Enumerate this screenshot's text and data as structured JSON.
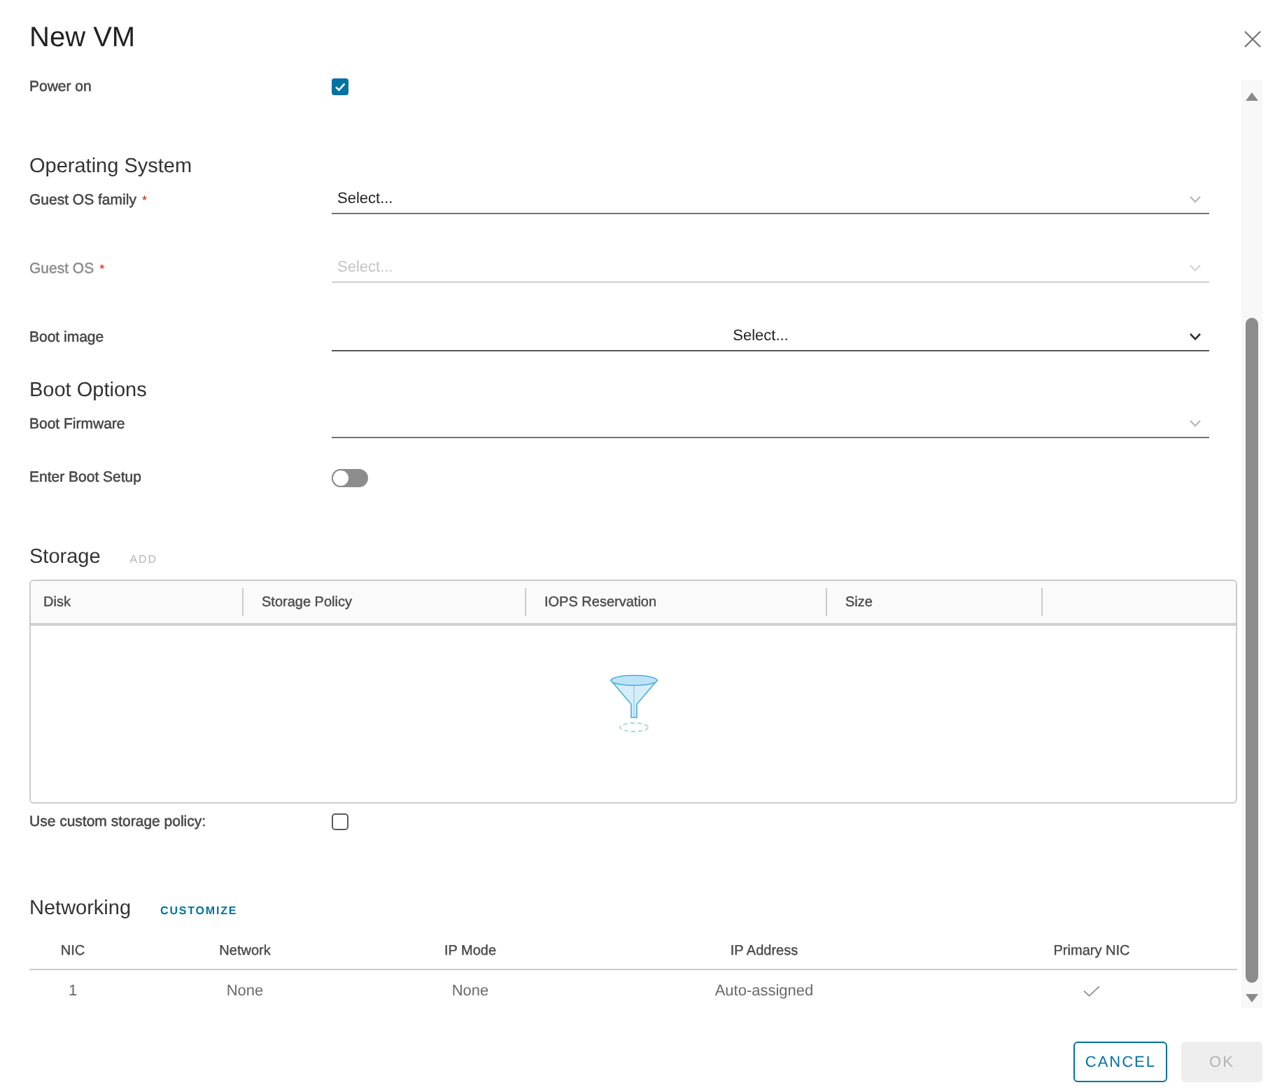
{
  "dialog": {
    "title": "New VM"
  },
  "fields": [
    {
      "kind": "checkbox",
      "label": "Power on",
      "checked": true
    }
  ],
  "sections": [
    {
      "title": "Operating System",
      "fields": [
        {
          "kind": "select",
          "label": "Guest OS family",
          "required_mark": "*",
          "value": "Select...",
          "disabled": false
        },
        {
          "kind": "select",
          "label": "Guest OS",
          "required_mark": "*",
          "value": "Select...",
          "disabled": true
        },
        {
          "kind": "native-select",
          "label": "Boot image",
          "value": "Select...",
          "disabled": false
        }
      ]
    },
    {
      "title": "Boot Options",
      "fields": [
        {
          "kind": "select",
          "label": "Boot Firmware",
          "disabled": false
        },
        {
          "kind": "toggle",
          "label": "Enter Boot Setup",
          "on": false
        }
      ]
    },
    {
      "title": "Storage",
      "action": {
        "label": "ADD",
        "disabled": true
      },
      "grid": {
        "columns": [
          "Disk",
          "Storage Policy",
          "IOPS Reservation",
          "Size"
        ]
      },
      "fields": [
        {
          "kind": "checkbox",
          "label": "Use custom storage policy:",
          "checked": false
        }
      ]
    },
    {
      "title": "Networking",
      "action": {
        "label": "CUSTOMIZE",
        "disabled": false
      },
      "table": {
        "columns": [
          "NIC",
          "Network",
          "IP Mode",
          "IP Address",
          "Primary NIC"
        ],
        "rows": [
          {
            "cells": [
              "1",
              "None",
              "None",
              "Auto-assigned"
            ],
            "primary": true
          }
        ]
      }
    }
  ],
  "buttons": [
    {
      "kind": "cancel",
      "label": "CANCEL",
      "disabled": false
    },
    {
      "kind": "confirm",
      "label": "OK",
      "disabled": true
    }
  ]
}
